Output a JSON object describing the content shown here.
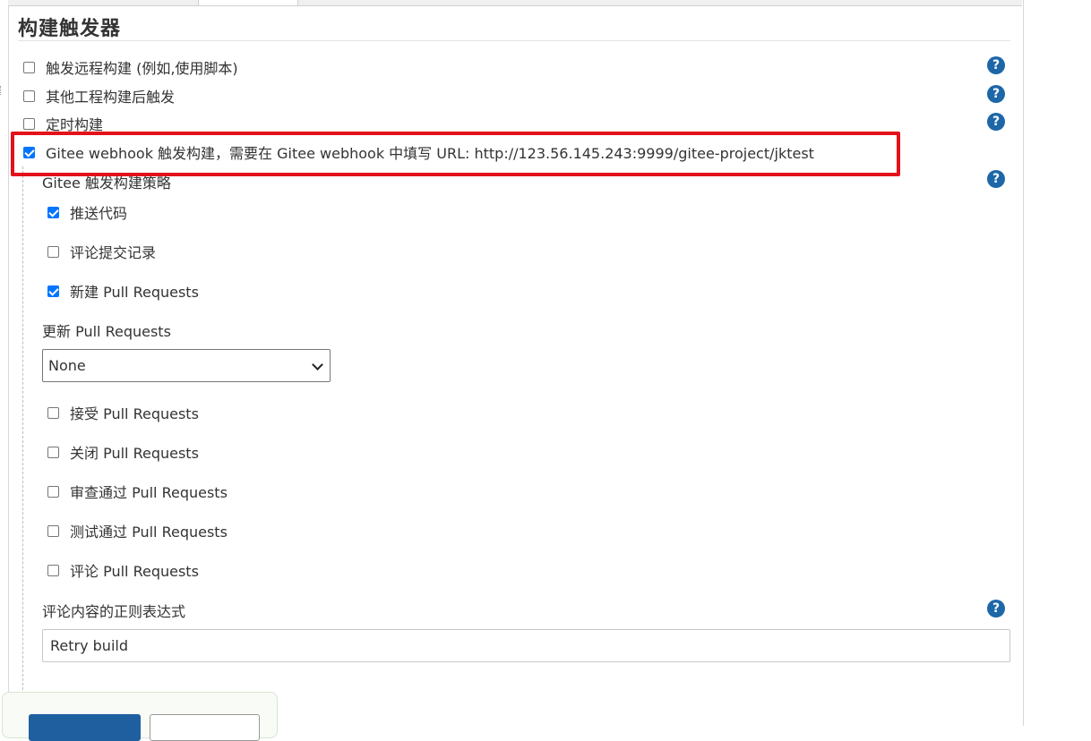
{
  "section": {
    "title": "构建触发器"
  },
  "triggers": [
    {
      "label": "触发远程构建 (例如,使用脚本)",
      "checked": false
    },
    {
      "label": "其他工程构建后触发",
      "checked": false
    },
    {
      "label": "定时构建",
      "checked": false
    },
    {
      "label": "Gitee webhook 触发构建，需要在 Gitee webhook 中填写 URL: http://123.56.145.243:9999/gitee-project/jktest",
      "checked": true
    }
  ],
  "strategy": {
    "heading": "Gitee 触发构建策略",
    "options": [
      {
        "label": "推送代码",
        "checked": true
      },
      {
        "label": "评论提交记录",
        "checked": false
      },
      {
        "label": "新建 Pull Requests",
        "checked": true
      }
    ],
    "update_label": "更新 Pull Requests",
    "update_select_value": "None",
    "more_options": [
      {
        "label": "接受 Pull Requests",
        "checked": false
      },
      {
        "label": "关闭 Pull Requests",
        "checked": false
      },
      {
        "label": "审查通过 Pull Requests",
        "checked": false
      },
      {
        "label": "测试通过 Pull Requests",
        "checked": false
      },
      {
        "label": "评论 Pull Requests",
        "checked": false
      }
    ],
    "regex_label": "评论内容的正则表达式",
    "regex_value": "Retry build"
  },
  "help_glyph": "?",
  "colors": {
    "highlight": "#e3111b",
    "checkbox": "#0075ff",
    "help": "#1d67a8",
    "primary_button": "#1f5fa0"
  }
}
